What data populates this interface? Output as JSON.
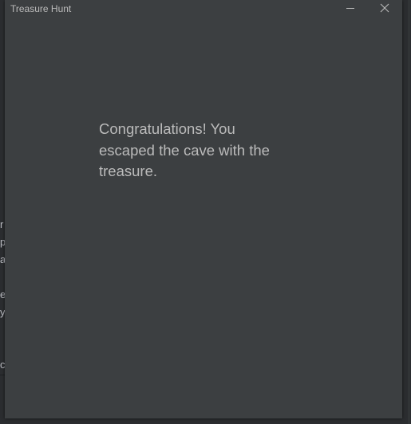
{
  "window": {
    "title": "Treasure Hunt",
    "minimize_icon": "minimize-icon",
    "close_icon": "close-icon"
  },
  "main": {
    "message": "Congratulations! You\nescaped the cave with the\ntreasure."
  },
  "background": {
    "letters": [
      "r",
      "p",
      "a",
      "e",
      "y",
      "c"
    ]
  },
  "colors": {
    "window_bg": "#3c3f41",
    "text": "#bbbbbb",
    "desktop_bg": "#2b2d30"
  }
}
